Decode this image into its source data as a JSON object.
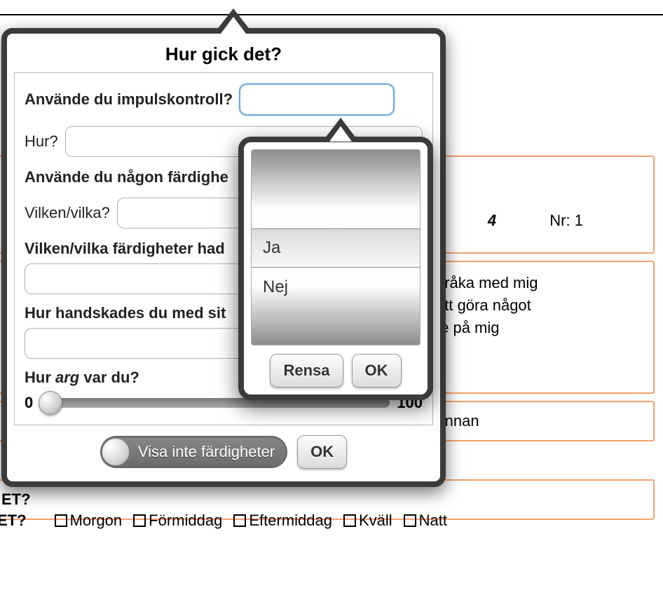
{
  "background": {
    "nr_suffix": "4",
    "nr_label": "Nr:",
    "nr_value": "1",
    "lines": [
      "bråka med mig",
      "att göra något",
      "te på mig"
    ],
    "box3": "Annan",
    "et_label": "ET?",
    "time_options": [
      "Morgon",
      "Förmiddag",
      "Eftermiddag",
      "Kväll",
      "Natt"
    ],
    "et2_label": "ET?"
  },
  "dialog": {
    "title": "Hur gick det?",
    "q1": "Använde du impulskontroll?",
    "q2": "Hur?",
    "q3": "Använde du någon färdighe",
    "q4": "Vilken/vilka?",
    "q5": "Vilken/vilka färdigheter had",
    "q6": "Hur handskades du med sit",
    "q7_pre": "Hur ",
    "q7_ital": "arg",
    "q7_post": " var du?",
    "slider_min": "0",
    "slider_max": "100",
    "toggle_label": "Visa inte färdigheter",
    "ok": "OK"
  },
  "picker": {
    "options": [
      "Ja",
      "Nej"
    ],
    "clear": "Rensa",
    "ok": "OK"
  }
}
